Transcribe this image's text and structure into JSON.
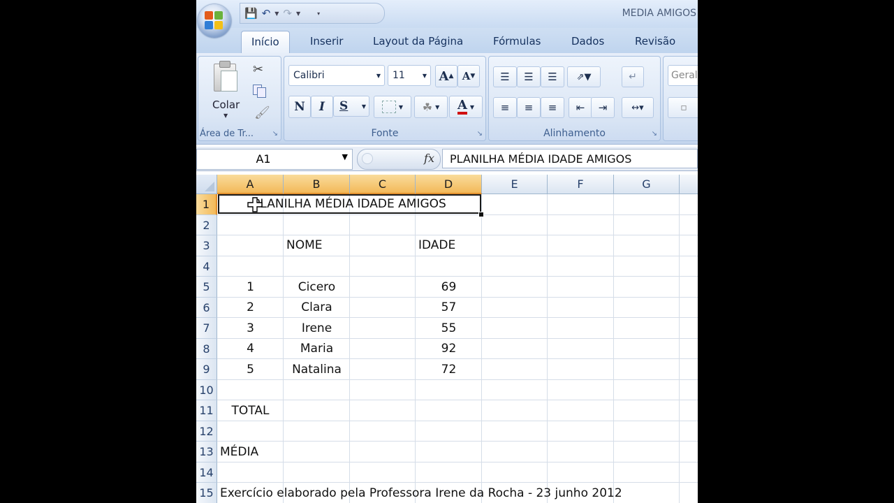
{
  "window": {
    "title": "MEDIA AMIGOS"
  },
  "ribbon": {
    "tabs": [
      "Início",
      "Inserir",
      "Layout da Página",
      "Fórmulas",
      "Dados",
      "Revisão"
    ],
    "clipboard": {
      "paste_label": "Colar",
      "group_label": "Área de Tr..."
    },
    "font": {
      "name": "Calibri",
      "size": "11",
      "bold": "N",
      "italic": "I",
      "underline": "S",
      "grow": "A",
      "shrink": "A",
      "color_letter": "A",
      "group_label": "Fonte"
    },
    "alignment": {
      "group_label": "Alinhamento"
    },
    "number": {
      "format": "Geral"
    }
  },
  "formula_bar": {
    "name_box": "A1",
    "fx": "fx",
    "content": "PLANILHA MÉDIA IDADE AMIGOS"
  },
  "sheet": {
    "columns": [
      "A",
      "B",
      "C",
      "D",
      "E",
      "F",
      "G"
    ],
    "rows": [
      "1",
      "2",
      "3",
      "4",
      "5",
      "6",
      "7",
      "8",
      "9",
      "10",
      "11",
      "12",
      "13",
      "14",
      "15"
    ],
    "cells": {
      "A1": "PLANILHA MÉDIA IDADE AMIGOS",
      "B3": "NOME",
      "D3": "IDADE",
      "A5": "1",
      "B5": "Cicero",
      "D5": "69",
      "A6": "2",
      "B6": "Clara",
      "D6": "57",
      "A7": "3",
      "B7": "Irene",
      "D7": "55",
      "A8": "4",
      "B8": "Maria",
      "D8": "92",
      "A9": "5",
      "B9": "Natalina",
      "D9": "72",
      "A11": "TOTAL",
      "A13": "MÉDIA",
      "A15": "Exercício elaborado pela Professora Irene da Rocha - 23 junho 2012"
    }
  }
}
